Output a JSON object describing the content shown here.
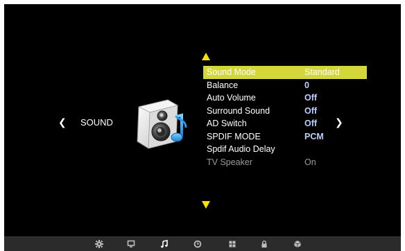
{
  "screen": {
    "section_title": "SOUND",
    "left_nav": "❮",
    "right_nav": "❯",
    "icon": "speaker-music-icon"
  },
  "menu": {
    "items": [
      {
        "label": "Sound Mode",
        "value": "Standard",
        "state": "selected"
      },
      {
        "label": "Balance",
        "value": "0",
        "state": "normal"
      },
      {
        "label": "Auto Volume",
        "value": "Off",
        "state": "normal"
      },
      {
        "label": "Surround Sound",
        "value": "Off",
        "state": "normal"
      },
      {
        "label": "AD Switch",
        "value": "Off",
        "state": "normal"
      },
      {
        "label": "SPDIF MODE",
        "value": "PCM",
        "state": "normal"
      },
      {
        "label": "Spdif Audio Delay",
        "value": "",
        "state": "normal"
      },
      {
        "label": "TV Speaker",
        "value": "On",
        "state": "disabled"
      }
    ]
  },
  "bottom_tabs": [
    {
      "name": "settings-gear-icon",
      "active": false
    },
    {
      "name": "picture-monitor-icon",
      "active": false
    },
    {
      "name": "sound-note-icon",
      "active": true
    },
    {
      "name": "time-clock-icon",
      "active": false
    },
    {
      "name": "option-grid-icon",
      "active": false
    },
    {
      "name": "lock-icon",
      "active": false
    },
    {
      "name": "channel-cube-icon",
      "active": false
    }
  ],
  "colors": {
    "highlight": "#d3d73a",
    "value_text": "#b9cfff",
    "arrow": "#f2e400",
    "background": "#000000"
  }
}
